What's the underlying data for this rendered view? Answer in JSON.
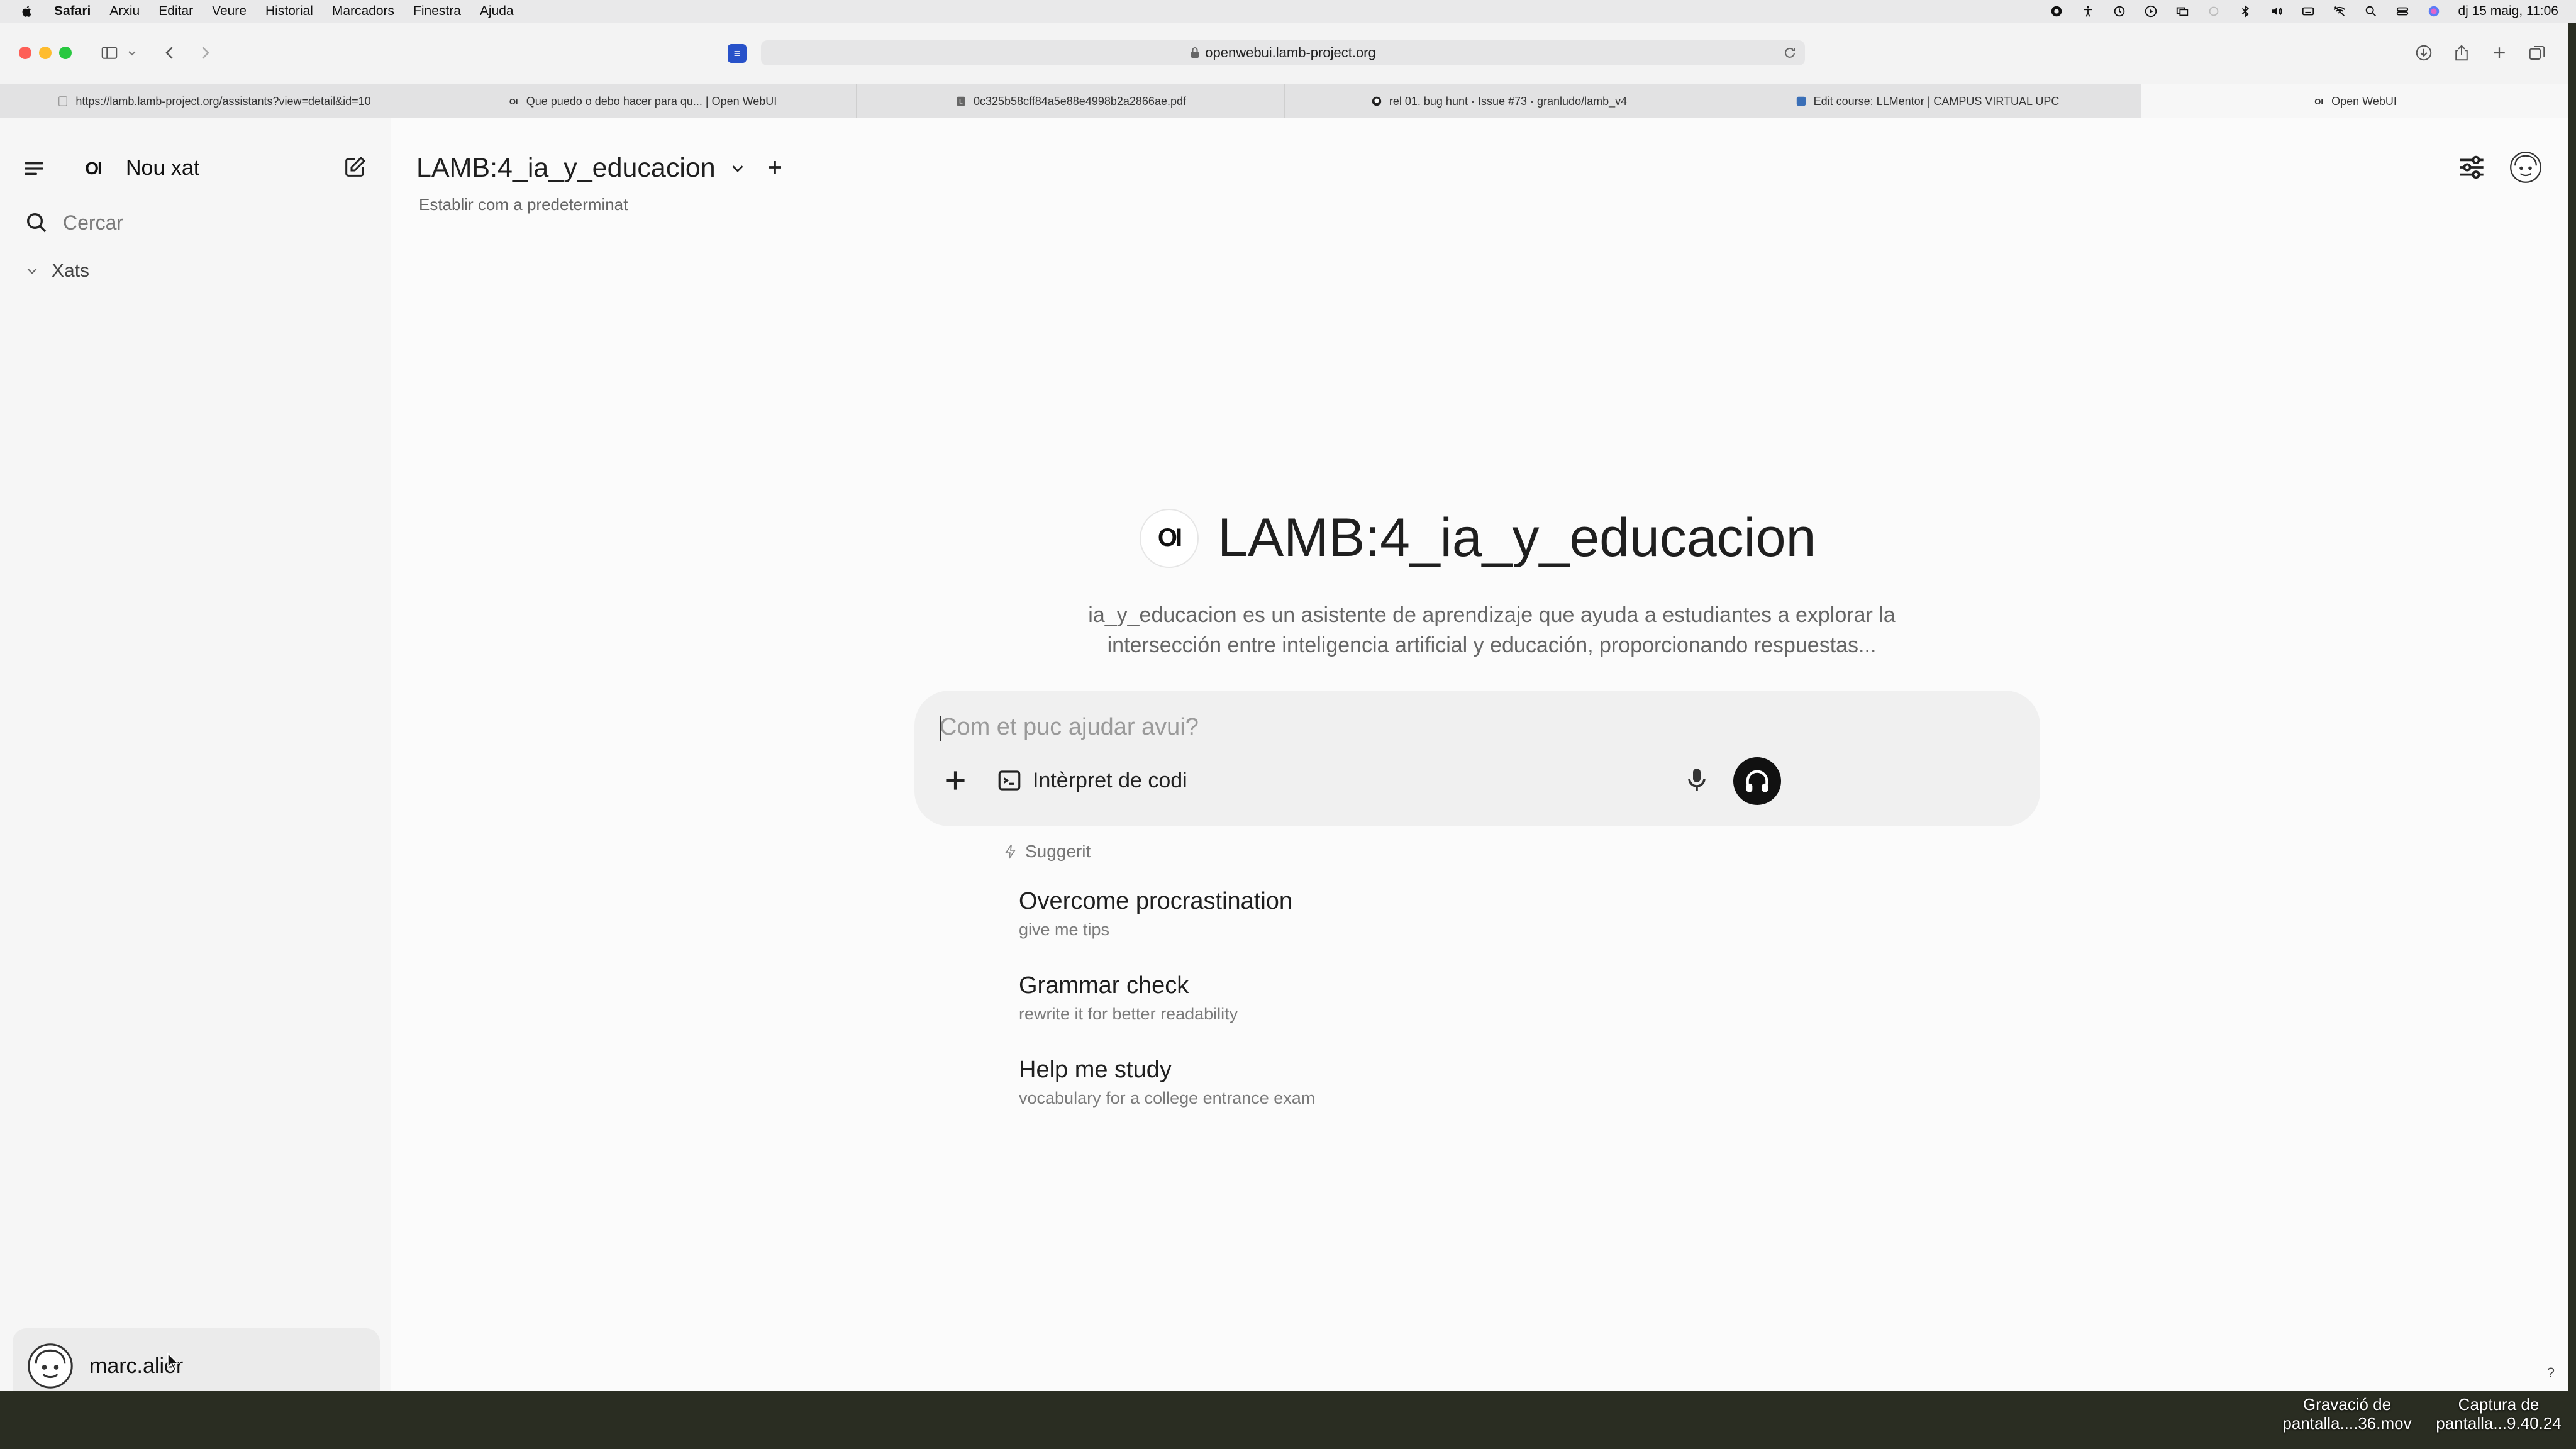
{
  "menubar": {
    "app": "Safari",
    "items": [
      "Arxiu",
      "Editar",
      "Veure",
      "Historial",
      "Marcadors",
      "Finestra",
      "Ajuda"
    ],
    "clock": "dj 15 maig, 11:06"
  },
  "browser": {
    "address": "openwebui.lamb-project.org",
    "tabs": [
      {
        "title": "https://lamb.lamb-project.org/assistants?view=detail&id=10",
        "icon": "page-icon"
      },
      {
        "title": "Que puedo o debo hacer para qu... | Open WebUI",
        "icon": "openwebui-icon"
      },
      {
        "title": "0c325b58cff84a5e88e4998b2a2866ae.pdf",
        "icon": "pdf-icon"
      },
      {
        "title": "rel 01. bug hunt · Issue #73 · granludo/lamb_v4",
        "icon": "github-icon"
      },
      {
        "title": "Edit course: LLMentor | CAMPUS VIRTUAL UPC",
        "icon": "moodle-icon"
      },
      {
        "title": "Open WebUI",
        "icon": "openwebui-icon"
      }
    ]
  },
  "sidebar": {
    "logo": "OI",
    "new_chat": "Nou xat",
    "search_placeholder": "Cercar",
    "chats_header": "Xats",
    "user_name": "marc.alier"
  },
  "main": {
    "model_name": "LAMB:4_ia_y_educacion",
    "set_default": "Establir com a predeterminat",
    "hero_logo": "OI",
    "hero_title": "LAMB:4_ia_y_educacion",
    "hero_description": "ia_y_educacion es un asistente de aprendizaje que ayuda a estudiantes a explorar la intersección entre inteligencia artificial y educación, proporcionando respuestas...",
    "prompt_placeholder": "Com et puc ajudar avui?",
    "code_interpreter": "Intèrpret de codi",
    "suggested_label": "Suggerit",
    "suggestions": [
      {
        "title": "Overcome procrastination",
        "subtitle": "give me tips"
      },
      {
        "title": "Grammar check",
        "subtitle": "rewrite it for better readability"
      },
      {
        "title": "Help me study",
        "subtitle": "vocabulary for a college entrance exam"
      }
    ],
    "help": "?"
  },
  "desktop": {
    "file1": "Gravació de pantalla....36.mov",
    "file2": "Captura de pantalla...9.40.24"
  },
  "colors": {
    "accent": "#111111",
    "sidebar_bg": "#f6f6f6",
    "composer_bg": "#f0f0f0"
  }
}
